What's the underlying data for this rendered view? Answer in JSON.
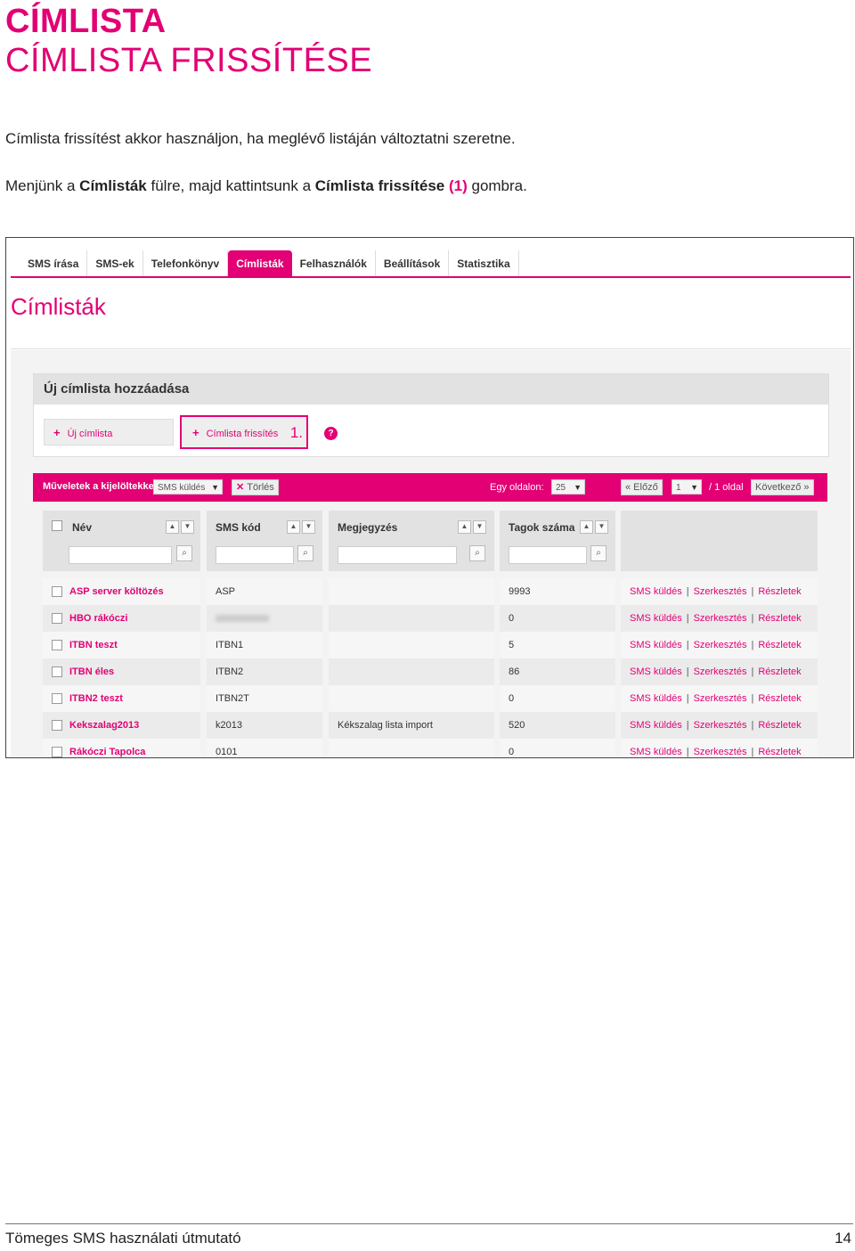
{
  "heading": {
    "title": "CÍMLISTA",
    "subtitle": "CÍMLISTA FRISSÍTÉSE"
  },
  "intro": "Címlista frissítést akkor használjon, ha meglévő listáján változtatni szeretne.",
  "instruction": {
    "part1": "Menjünk a ",
    "bold1": "Címlisták",
    "part2": " fülre, majd kattintsunk a ",
    "bold2": "Címlista frissítése",
    "num": " (1)",
    "part3": " gombra."
  },
  "screenshot": {
    "tabs": [
      "SMS írása",
      "SMS-ek",
      "Telefonkönyv",
      "Címlisták",
      "Felhasználók",
      "Beállítások",
      "Statisztika"
    ],
    "active_tab": "Címlisták",
    "page_title": "Címlisták",
    "add_box": {
      "title": "Új címlista hozzáadása",
      "new_button": "Új címlista",
      "refresh_button": "Címlista frissítés",
      "step_label": "1.",
      "help": "?"
    },
    "op_bar": {
      "label": "Műveletek a kijelöltekkel:",
      "action_select": "SMS küldés",
      "delete": "Törlés",
      "per_page_label": "Egy oldalon:",
      "per_page": "25",
      "prev": "« Előző",
      "page": "1",
      "page_of": "/ 1 oldal",
      "next": "Következő »"
    },
    "columns": [
      "Név",
      "SMS kód",
      "Megjegyzés",
      "Tagok száma"
    ],
    "rows": [
      {
        "name": "ASP server költözés",
        "code": "ASP",
        "note": "",
        "members": "9993"
      },
      {
        "name": "HBO rákóczi",
        "code": "",
        "note": "",
        "members": "0"
      },
      {
        "name": "ITBN teszt",
        "code": "ITBN1",
        "note": "",
        "members": "5"
      },
      {
        "name": "ITBN éles",
        "code": "ITBN2",
        "note": "",
        "members": "86"
      },
      {
        "name": "ITBN2 teszt",
        "code": "ITBN2T",
        "note": "",
        "members": "0"
      },
      {
        "name": "Kekszalag2013",
        "code": "k2013",
        "note": "Kékszalag lista import",
        "members": "520"
      },
      {
        "name": "Rákóczi Tapolca",
        "code": "0101",
        "note": "",
        "members": "0"
      }
    ],
    "row_links": {
      "send": "SMS küldés",
      "edit": "Szerkesztés",
      "details": "Részletek"
    }
  },
  "footer": {
    "title": "Tömeges SMS használati útmutató",
    "page": "14"
  },
  "colors": {
    "magenta": "#e20074"
  }
}
